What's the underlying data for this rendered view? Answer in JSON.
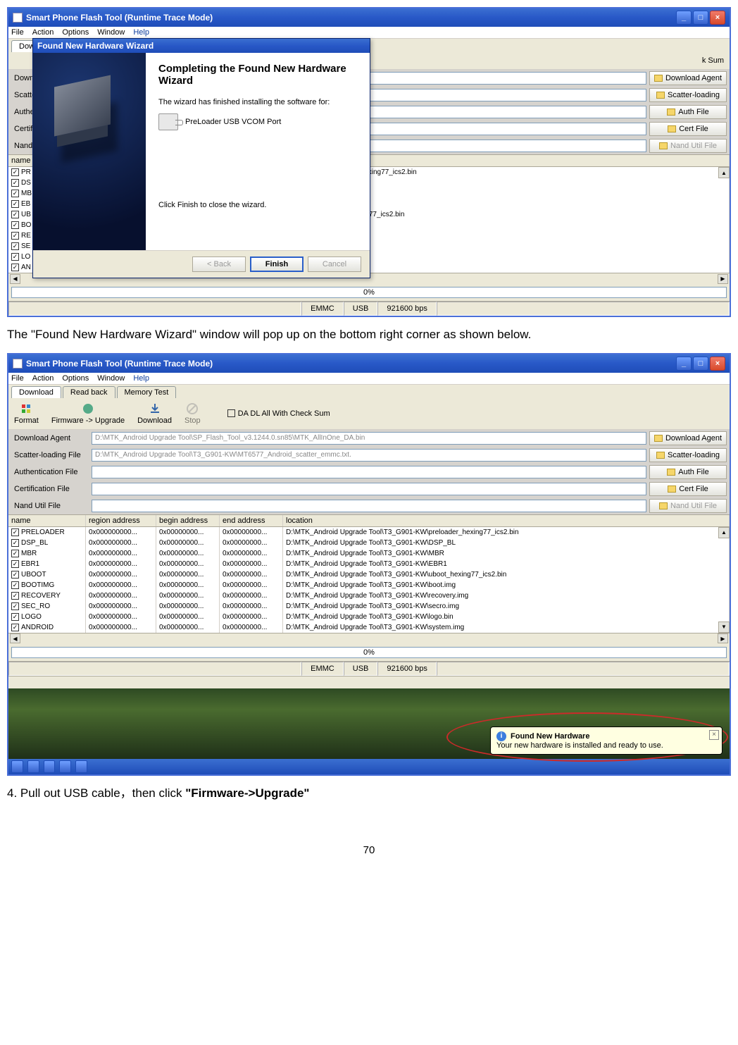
{
  "doc": {
    "caption1": "The \"Found New Hardware Wizard\" window will pop up on the bottom right corner as shown below.",
    "step4_a": "4. Pull out USB cable，then click ",
    "step4_b": "\"Firmware->Upgrade\"",
    "page_num": "70"
  },
  "app": {
    "title": "Smart Phone Flash Tool (Runtime Trace Mode)",
    "menu": {
      "file": "File",
      "action": "Action",
      "options": "Options",
      "window": "Window",
      "help": "Help"
    },
    "tabs": {
      "download": "Download",
      "readback": "Read back",
      "memtest": "Memory Test"
    },
    "toolbar": {
      "format": "Format",
      "firmware": "Firmware -> Upgrade",
      "download": "Download",
      "stop": "Stop",
      "checksum": "DA DL All With Check Sum"
    },
    "files": {
      "da_label": "Download Agent",
      "da_val": "D:\\MTK_Android Upgrade Tool\\SP_Flash_Tool_v3.1244.0.sn85\\MTK_AllInOne_DA.bin",
      "da_btn": "Download Agent",
      "sc_label": "Scatter-loading File",
      "sc_val": "D:\\MTK_Android Upgrade Tool\\T3_G901-KW\\MT6577_Android_scatter_emmc.txt.",
      "sc_btn": "Scatter-loading",
      "au_label": "Authentication File",
      "au_btn": "Auth File",
      "ce_label": "Certification File",
      "ce_btn": "Cert File",
      "na_label": "Nand Util File",
      "na_btn": "Nand Util File"
    },
    "cols": {
      "name": "name",
      "ra": "region address",
      "ba": "begin address",
      "ea": "end address",
      "loc": "location"
    },
    "rows1_names": [
      "PR",
      "DS",
      "MB",
      "EB",
      "UB",
      "BO",
      "RE",
      "SE",
      "LO",
      "AN"
    ],
    "rows1_locs": [
      "3_G901-KW\\preloader_hexing77_ics2.bin",
      "3_G901-KW\\DSP_BL",
      "3_G901-KW\\MBR",
      "3_G901-KW\\EBR1",
      "3_G901-KW\\uboot_hexing77_ics2.bin",
      "3_G901-KW\\boot.img",
      "3_G901-KW\\recovery.img",
      "3_G901-KW\\secro.img",
      "3_G901-KW\\logo.bin",
      "3_G901-KW\\system.img"
    ],
    "rows2": [
      {
        "n": "PRELOADER",
        "loc": "D:\\MTK_Android Upgrade Tool\\T3_G901-KW\\preloader_hexing77_ics2.bin"
      },
      {
        "n": "DSP_BL",
        "loc": "D:\\MTK_Android Upgrade Tool\\T3_G901-KW\\DSP_BL"
      },
      {
        "n": "MBR",
        "loc": "D:\\MTK_Android Upgrade Tool\\T3_G901-KW\\MBR"
      },
      {
        "n": "EBR1",
        "loc": "D:\\MTK_Android Upgrade Tool\\T3_G901-KW\\EBR1"
      },
      {
        "n": "UBOOT",
        "loc": "D:\\MTK_Android Upgrade Tool\\T3_G901-KW\\uboot_hexing77_ics2.bin"
      },
      {
        "n": "BOOTIMG",
        "loc": "D:\\MTK_Android Upgrade Tool\\T3_G901-KW\\boot.img"
      },
      {
        "n": "RECOVERY",
        "loc": "D:\\MTK_Android Upgrade Tool\\T3_G901-KW\\recovery.img"
      },
      {
        "n": "SEC_RO",
        "loc": "D:\\MTK_Android Upgrade Tool\\T3_G901-KW\\secro.img"
      },
      {
        "n": "LOGO",
        "loc": "D:\\MTK_Android Upgrade Tool\\T3_G901-KW\\logo.bin"
      },
      {
        "n": "ANDROID",
        "loc": "D:\\MTK_Android Upgrade Tool\\T3_G901-KW\\system.img"
      }
    ],
    "addr_ra": "0x000000000...",
    "addr_ba": "0x00000000...",
    "addr_ea": "0x00000000...",
    "progress": "0%",
    "status": {
      "emmc": "EMMC",
      "usb": "USB",
      "bps": "921600 bps"
    }
  },
  "wizard": {
    "title": "Found New Hardware Wizard",
    "heading": "Completing the Found New Hardware Wizard",
    "line1": "The wizard has finished installing the software for:",
    "device": "PreLoader USB VCOM Port",
    "line2": "Click Finish to close the wizard.",
    "back": "< Back",
    "finish": "Finish",
    "cancel": "Cancel"
  },
  "balloon": {
    "title": "Found New Hardware",
    "msg": "Your new hardware is installed and ready to use."
  }
}
